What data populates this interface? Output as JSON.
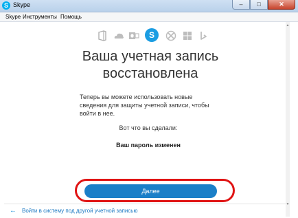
{
  "window": {
    "title": "Skype",
    "min_label": "–",
    "max_label": "□",
    "close_label": "✕",
    "app_icon": "S"
  },
  "menu": {
    "skype": "Skype",
    "tools": "Инструменты",
    "help": "Помощь"
  },
  "services": [
    "office-icon",
    "onedrive-icon",
    "outlook-icon",
    "skype-icon",
    "xbox-icon",
    "windows-icon",
    "bing-icon"
  ],
  "skype_glyph": "S",
  "main": {
    "heading_line1": "Ваша учетная запись",
    "heading_line2": "восстановлена",
    "body_line1": "Теперь вы можете использовать новые",
    "body_line2": "сведения для защиты учетной записи, чтобы",
    "body_line3": "войти в нее.",
    "done_label": "Вот что вы сделали:",
    "password_changed": "Ваш пароль изменен",
    "next_label": "Далее"
  },
  "footer": {
    "arrow": "←",
    "link": "Войти в систему под другой учетной записью"
  },
  "colors": {
    "accent": "#1a7fc8",
    "highlight": "#e01414",
    "skype": "#1b9de2"
  }
}
